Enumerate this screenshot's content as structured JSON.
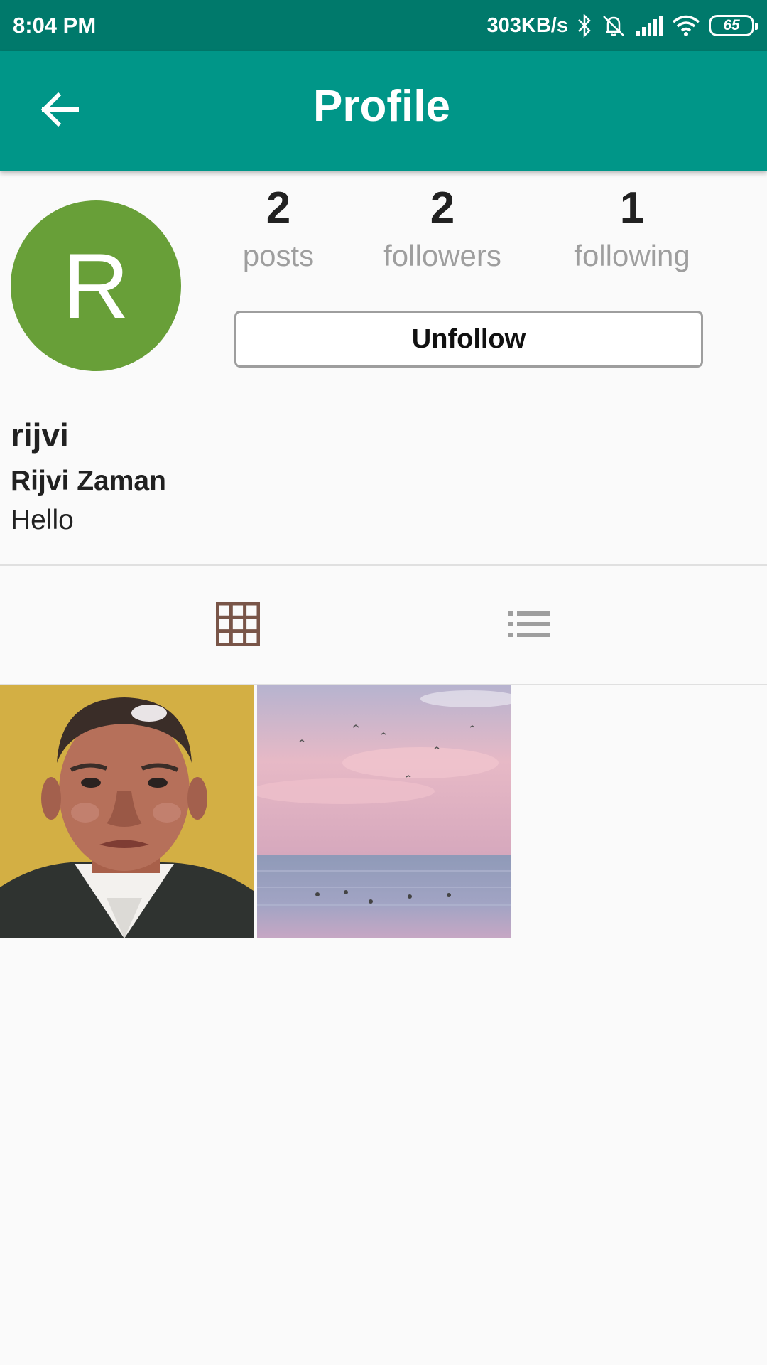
{
  "status_bar": {
    "time": "8:04 PM",
    "net_speed": "303KB/s",
    "battery": "65",
    "icons": [
      "bluetooth-icon",
      "mute-bell-icon",
      "signal-icon",
      "wifi-icon",
      "battery-icon"
    ]
  },
  "app_bar": {
    "title": "Profile",
    "back_icon": "arrow-back-icon"
  },
  "profile": {
    "avatar_initial": "R",
    "avatar_color": "#689f38",
    "stats": [
      {
        "value": "2",
        "label": "posts"
      },
      {
        "value": "2",
        "label": "followers"
      },
      {
        "value": "1",
        "label": "following"
      }
    ],
    "action_label": "Unfollow",
    "username": "rijvi",
    "full_name": "Rijvi Zaman",
    "bio": "Hello"
  },
  "tabs": [
    {
      "icon": "grid-icon",
      "active": true
    },
    {
      "icon": "list-icon",
      "active": false
    }
  ],
  "posts": [
    {
      "subject": "portrait painting"
    },
    {
      "subject": "pink sky over sea"
    }
  ],
  "colors": {
    "primary": "#009688",
    "primary_dark": "#00796b",
    "active_tab_icon": "#795548",
    "inactive_tab_icon": "#9e9e9e"
  }
}
